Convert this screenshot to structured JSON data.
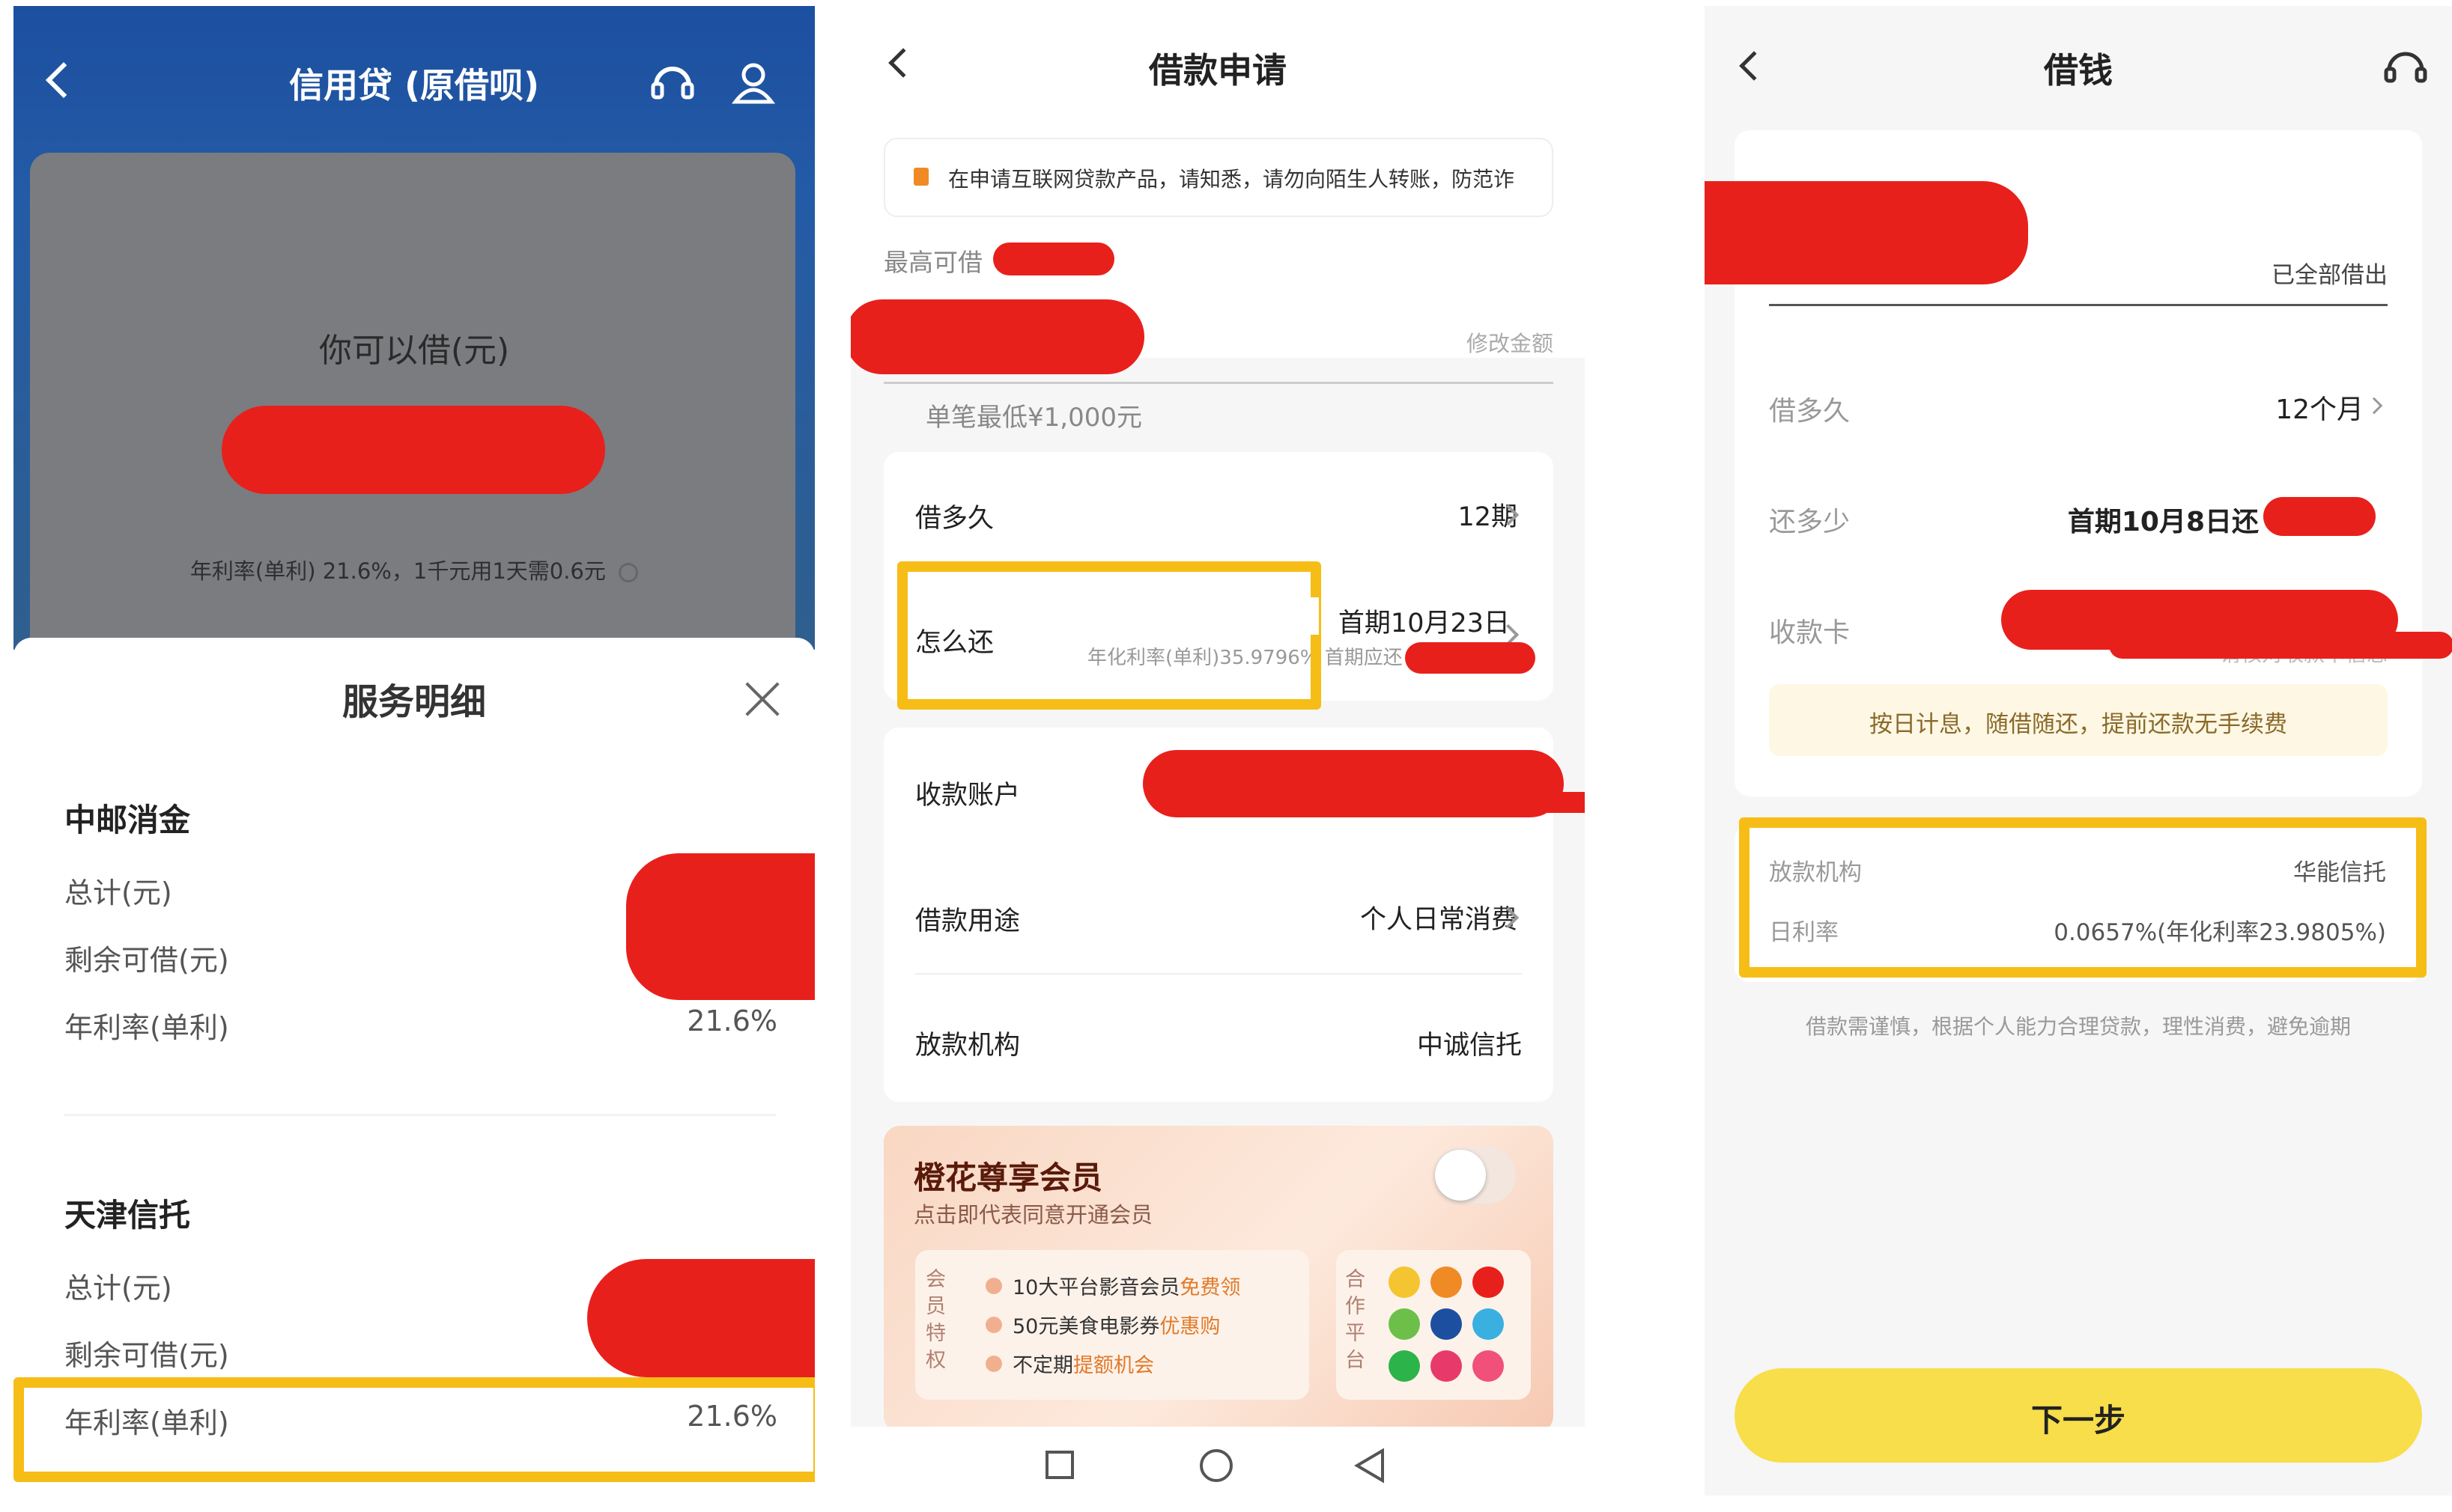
{
  "p1": {
    "title": "信用贷 (原借呗)",
    "can_borrow_label": "你可以借(元)",
    "rate_line": "年利率(单利) 21.6%，1千元用1天需0.6元",
    "sheet_title": "服务明细",
    "sections": [
      {
        "name": "中邮消金",
        "rows": [
          {
            "label": "总计(元)",
            "value": ""
          },
          {
            "label": "剩余可借(元)",
            "value": ""
          },
          {
            "label": "年利率(单利)",
            "value": "21.6%"
          }
        ]
      },
      {
        "name": "天津信托",
        "rows": [
          {
            "label": "总计(元)",
            "value": ""
          },
          {
            "label": "剩余可借(元)",
            "value": ""
          },
          {
            "label": "年利率(单利)",
            "value": "21.6%"
          }
        ]
      }
    ],
    "icons": [
      "back-icon",
      "headset-icon",
      "user-icon",
      "close-icon",
      "info-icon"
    ]
  },
  "p2": {
    "title": "借款申请",
    "notice": "在申请互联网贷款产品，请知悉，请勿向陌生人转账，防范诈",
    "max_label": "最高可借",
    "modify_label": "修改金额",
    "min_note": "单笔最低¥1,000元",
    "term_label": "借多久",
    "term_value": "12期",
    "repay_label": "怎么还",
    "repay_value": "首期10月23日",
    "repay_sub": "年化利率(单利)35.9796% 首期应还",
    "account_label": "收款账户",
    "purpose_label": "借款用途",
    "purpose_value": "个人日常消费",
    "lender_label": "放款机构",
    "lender_value": "中诚信托",
    "member_title": "橙花尊享会员",
    "member_sub": "点击即代表同意开通会员",
    "member_toggle_on": false,
    "perk_side": "会员特权",
    "perks": [
      {
        "text": "10大平台影音会员",
        "highlight": "免费领"
      },
      {
        "text": "50元美食电影券",
        "highlight": "优惠购"
      },
      {
        "text": "不定期",
        "highlight": "提额机会"
      }
    ],
    "partner_side": "合作平台",
    "nav": [
      "square-nav-icon",
      "circle-nav-icon",
      "triangle-nav-icon"
    ]
  },
  "p3": {
    "title": "借钱",
    "all_lent": "已全部借出",
    "term_label": "借多久",
    "term_value": "12个月",
    "repay_label": "还多少",
    "repay_value": "首期10月8日还",
    "card_label": "收款卡",
    "card_sub": "请核对收款卡信息",
    "daily_banner": "按日计息，随借随还，提前还款无手续费",
    "lender_label": "放款机构",
    "lender_value": "华能信托",
    "rate_label": "日利率",
    "rate_value": "0.0657%(年化利率23.9805%)",
    "footer_note": "借款需谨慎，根据个人能力合理贷款，理性消费，避免逾期",
    "next_button": "下一步"
  },
  "colors": {
    "highlight_border": "#f6bd16",
    "redaction": "#e8201c",
    "next_button": "#f7de4a",
    "p1_header": "#1c4fa0"
  }
}
